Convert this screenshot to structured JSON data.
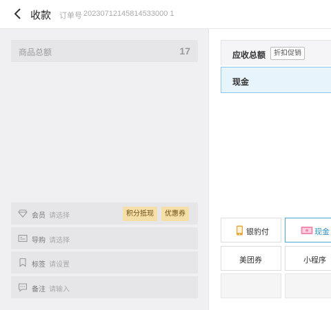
{
  "header": {
    "title": "收款",
    "order_label": "订单号",
    "order_no": "20230712145814533000 1"
  },
  "summary": {
    "total_label": "商品总额",
    "total_count": "17"
  },
  "options": {
    "member": {
      "label": "会员",
      "placeholder": "请选择",
      "points_btn": "积分抵现",
      "coupon_btn": "优惠券"
    },
    "guide": {
      "label": "导购",
      "placeholder": "请选择"
    },
    "tag": {
      "label": "标签",
      "placeholder": "请设置"
    },
    "remark": {
      "label": "备注",
      "placeholder": "请输入"
    }
  },
  "payment": {
    "due_label": "应收总额",
    "promo_btn": "折扣促销",
    "selected_method": "现金",
    "methods": [
      {
        "label": "银豹付",
        "icon": "phone-pay-icon"
      },
      {
        "label": "现金",
        "icon": "cash-icon"
      },
      {
        "label": "美团券",
        "icon": ""
      },
      {
        "label": "小程序",
        "icon": ""
      }
    ]
  },
  "colors": {
    "accent": "#2a8fba",
    "tag_bg": "#f6dea8",
    "panel_bg": "#f0f0f2"
  }
}
